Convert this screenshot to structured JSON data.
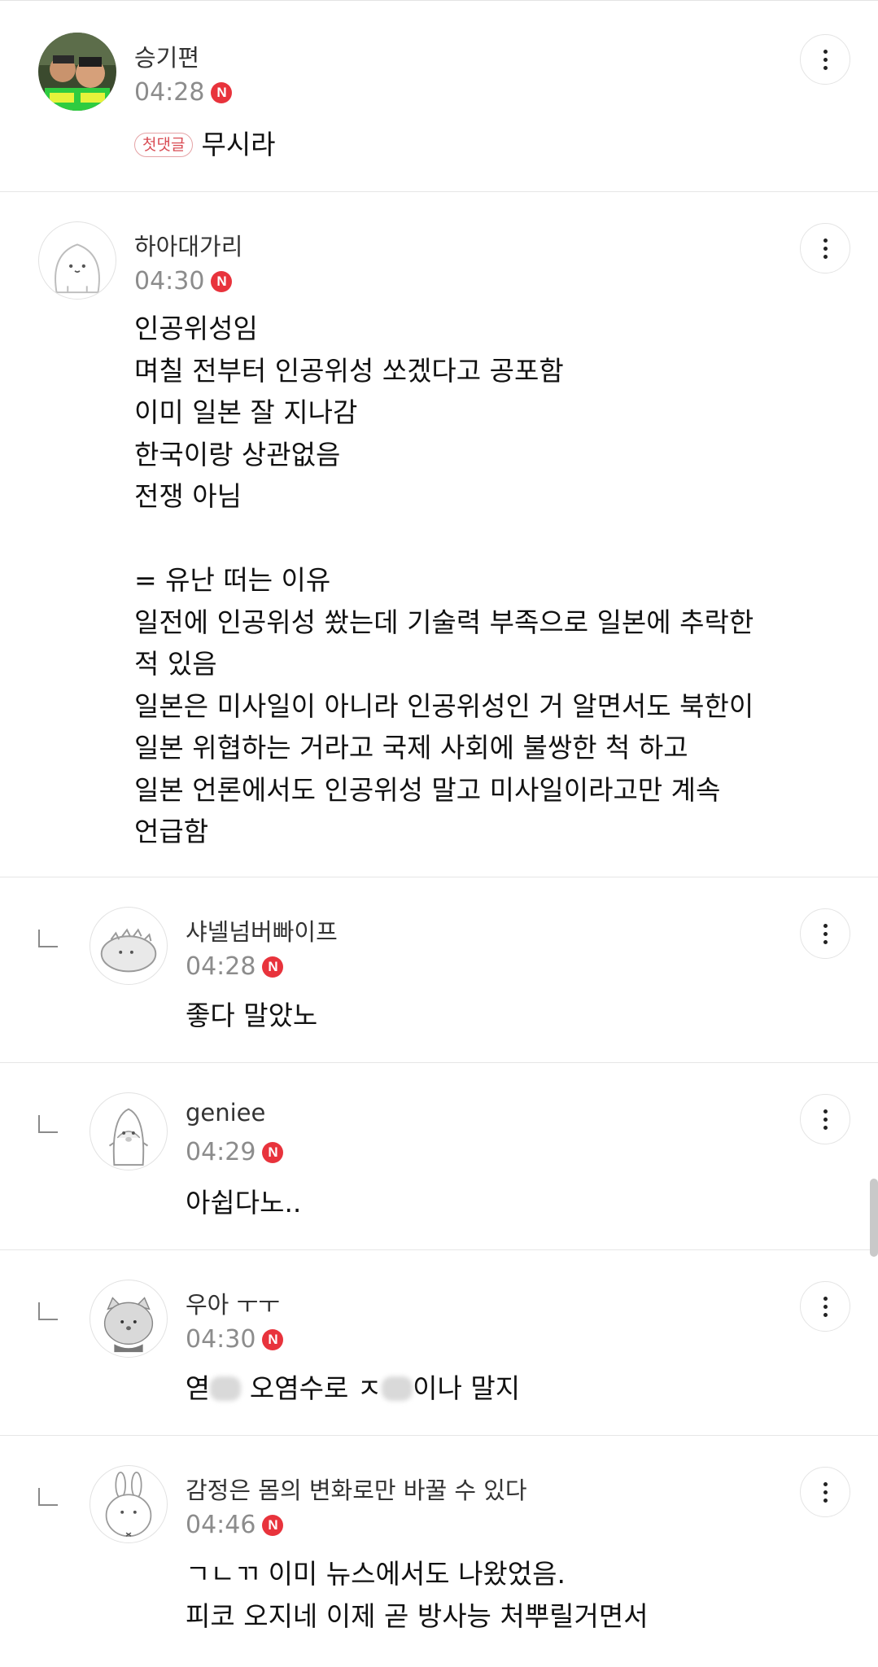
{
  "comments": [
    {
      "author": "승기편",
      "time": "04:28",
      "badge": "N",
      "first_tag": "첫댓글",
      "text": "무시라"
    },
    {
      "author": "하아대가리",
      "time": "04:30",
      "badge": "N",
      "text": "인공위성임\n며칠 전부터 인공위성 쏘겠다고 공포함\n이미 일본 잘 지나감\n한국이랑 상관없음\n전쟁 아님\n\n= 유난 떠는 이유\n일전에 인공위성 쐈는데 기술력 부족으로 일본에 추락한\n적 있음\n일본은 미사일이 아니라 인공위성인 거 알면서도 북한이\n일본 위협하는 거라고 국제 사회에 불쌍한 척 하고\n일본 언론에서도 인공위성 말고 미사일이라고만 계속\n언급함"
    }
  ],
  "replies": [
    {
      "author": "샤넬넘버빠이프",
      "time": "04:28",
      "badge": "N",
      "text": "좋다 말았노"
    },
    {
      "author": "geniee",
      "time": "04:29",
      "badge": "N",
      "text": "아쉽다노.."
    },
    {
      "author": "우아 ㅜㅜ",
      "time": "04:30",
      "badge": "N",
      "text_a": "엳",
      "text_b": " 오염수로 ㅈ",
      "text_c": "이나 말지"
    },
    {
      "author": "감정은 몸의 변화로만 바꿀 수 있다",
      "time": "04:46",
      "badge": "N",
      "text": "ㄱㄴㄲ 이미 뉴스에서도 나왔었음.\n피코 오지네 이제 곧 방사능 처뿌릴거면서"
    }
  ],
  "icons": {
    "more": "more-vertical-icon",
    "reply": "reply-arrow-icon",
    "badge_color": "#e8333c"
  }
}
